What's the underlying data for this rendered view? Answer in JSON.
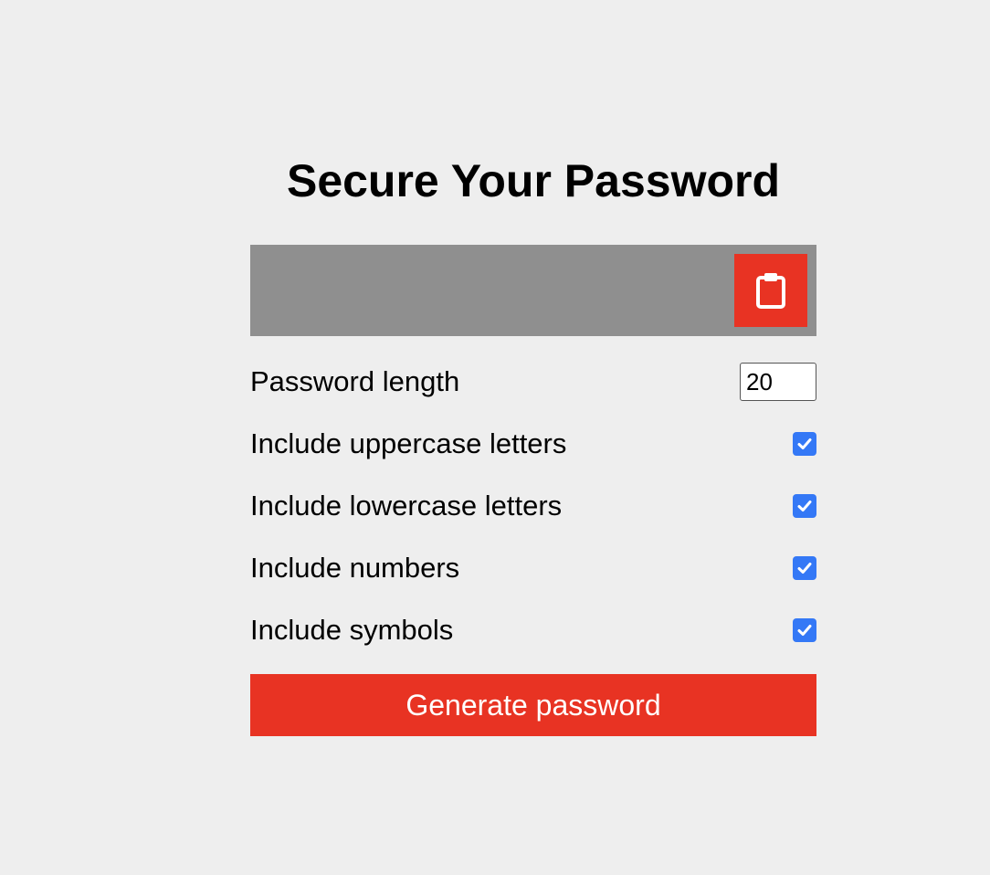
{
  "title": "Secure Your Password",
  "result": {
    "value": "",
    "copy_icon": "clipboard-icon"
  },
  "settings": {
    "length_label": "Password length",
    "length_value": "20",
    "options": [
      {
        "label": "Include uppercase letters",
        "checked": true
      },
      {
        "label": "Include lowercase letters",
        "checked": true
      },
      {
        "label": "Include numbers",
        "checked": true
      },
      {
        "label": "Include symbols",
        "checked": true
      }
    ]
  },
  "generate_label": "Generate password",
  "colors": {
    "background": "#eeeeee",
    "accent": "#e83323",
    "result_bg": "#8f8f8f",
    "checkbox": "#3478f6"
  }
}
